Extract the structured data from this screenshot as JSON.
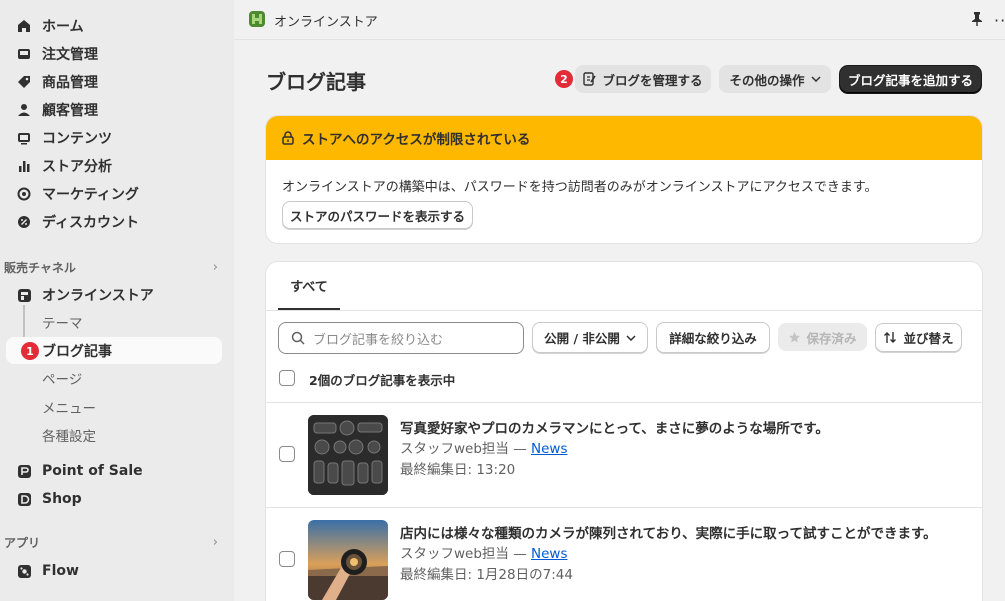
{
  "store": {
    "name": "オンラインストア"
  },
  "sidebar": {
    "main": [
      {
        "label": "ホーム",
        "icon": "home-icon"
      },
      {
        "label": "注文管理",
        "icon": "inbox-icon"
      },
      {
        "label": "商品管理",
        "icon": "tag-icon"
      },
      {
        "label": "顧客管理",
        "icon": "person-icon"
      },
      {
        "label": "コンテンツ",
        "icon": "image-icon"
      },
      {
        "label": "ストア分析",
        "icon": "bar-chart-icon"
      },
      {
        "label": "マーケティング",
        "icon": "target-icon"
      },
      {
        "label": "ディスカウント",
        "icon": "discount-icon"
      }
    ],
    "sales_channels_label": "販売チャネル",
    "online_store": {
      "label": "オンラインストア",
      "sub": [
        "テーマ",
        "ブログ記事",
        "ページ",
        "メニュー",
        "各種設定"
      ],
      "active_badge": "1"
    },
    "channels": [
      {
        "label": "Point of Sale"
      },
      {
        "label": "Shop"
      }
    ],
    "apps_label": "アプリ",
    "apps": [
      {
        "label": "Flow"
      }
    ]
  },
  "header": {
    "title": "ブログ記事",
    "badge": "2",
    "manage_blogs": "ブログを管理する",
    "more_actions": "その他の操作",
    "add_post": "ブログ記事を追加する"
  },
  "banner": {
    "title": "ストアへのアクセスが制限されている",
    "text": "オンラインストアの構築中は、パスワードを持つ訪問者のみがオンラインストアにアクセスできます。",
    "button": "ストアのパスワードを表示する"
  },
  "list": {
    "tab_all": "すべて",
    "search_placeholder": "ブログ記事を絞り込む",
    "filter_visibility": "公開 / 非公開",
    "filter_advanced": "詳細な絞り込み",
    "saved": "保存済み",
    "sort": "並び替え",
    "count_text": "2個のブログ記事を表示中",
    "posts": [
      {
        "title": "写真愛好家やプロのカメラマンにとって、まさに夢のような場所です。",
        "author": "スタッフweb担当 — ",
        "blog": "News",
        "edited": "最終編集日: 13:20"
      },
      {
        "title": "店内には様々な種類のカメラが陳列されており、実際に手に取って試すことができます。",
        "author": "スタッフweb担当 — ",
        "blog": "News",
        "edited": "最終編集日: 1月28日の7:44"
      }
    ]
  },
  "colors": {
    "banner": "#ffb800",
    "badge": "#e22c38",
    "link": "#005bd3",
    "primary_button": "#303030"
  }
}
